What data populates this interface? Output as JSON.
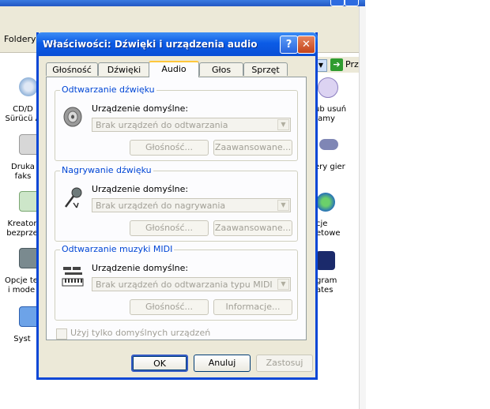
{
  "background": {
    "toolbar_label": "Foldery",
    "go_label": "Prze",
    "left_items": [
      {
        "line1": "CD/D",
        "line2": "Sürücü A"
      },
      {
        "line1": "Druka",
        "line2": "faks"
      },
      {
        "line1": "Kreator",
        "line2": "bezprze"
      },
      {
        "line1": "Opcje te",
        "line2": "i mode"
      },
      {
        "line1": "Syst",
        "line2": ""
      }
    ],
    "right_items": [
      {
        "line1": "ub usuń",
        "line2": "ramy"
      },
      {
        "line1": "ery gier",
        "line2": ""
      },
      {
        "line1": "cje",
        "line2": "etowe"
      },
      {
        "line1": "gram",
        "line2": "ates"
      }
    ]
  },
  "dialog": {
    "title": "Właściwości: Dźwięki i urządzenia audio",
    "help_glyph": "?",
    "close_glyph": "✕",
    "tabs": [
      {
        "label": "Głośność",
        "active": false
      },
      {
        "label": "Dźwięki",
        "active": false
      },
      {
        "label": "Audio",
        "active": true
      },
      {
        "label": "Głos",
        "active": false
      },
      {
        "label": "Sprzęt",
        "active": false
      }
    ],
    "playback": {
      "title": "Odtwarzanie dźwięku",
      "device_label": "Urządzenie domyślne:",
      "device_value": "Brak urządzeń do odtwarzania",
      "volume_button": "Głośność...",
      "advanced_button": "Zaawansowane...",
      "icon": "speaker-icon"
    },
    "recording": {
      "title": "Nagrywanie dźwięku",
      "device_label": "Urządzenie domyślne:",
      "device_value": "Brak urządzeń do nagrywania",
      "volume_button": "Głośność...",
      "advanced_button": "Zaawansowane...",
      "icon": "microphone-icon"
    },
    "midi": {
      "title": "Odtwarzanie muzyki MIDI",
      "device_label": "Urządzenie domyślne:",
      "device_value": "Brak urządzeń do odtwarzania typu MIDI",
      "volume_button": "Głośność...",
      "info_button": "Informacje...",
      "icon": "midi-keyboard-icon"
    },
    "default_only_checkbox": "Użyj tylko domyślnych urządzeń",
    "buttons": {
      "ok": "OK",
      "cancel": "Anuluj",
      "apply": "Zastosuj"
    }
  },
  "colors": {
    "title_blue": "#0a5be6",
    "group_title": "#0046d5",
    "active_tab_accent": "#ffc73c"
  }
}
